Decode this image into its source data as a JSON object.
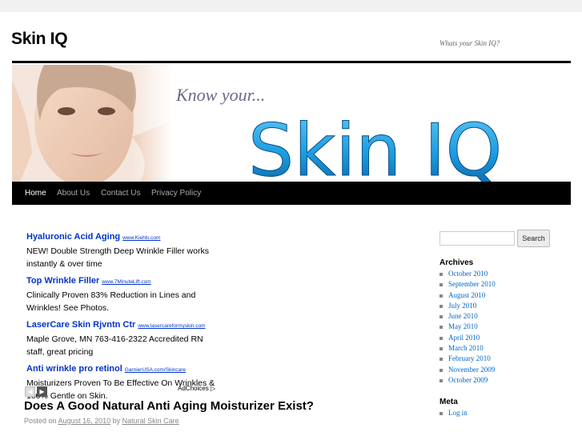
{
  "site": {
    "title": "Skin IQ",
    "description": "Whats your Skin IQ?"
  },
  "banner": {
    "tagline": "Know your...",
    "brand": "Skin IQ"
  },
  "nav": [
    {
      "label": "Home"
    },
    {
      "label": "About Us"
    },
    {
      "label": "Contact Us"
    },
    {
      "label": "Privacy Policy"
    }
  ],
  "ads": [
    {
      "title": "Hyaluronic Acid Aging",
      "url": "www.Kiehls.com",
      "text": "NEW! Double Strength Deep Wrinkle Filler works instantly & over time"
    },
    {
      "title": "Top Wrinkle Filler",
      "url": "www.7MinuteLift.com",
      "text": "Clinically Proven 83% Reduction in Lines and Wrinkles! See Photos."
    },
    {
      "title": "LaserCare Skin Rjvntn Ctr",
      "url": "www.lasercareformyskin.com",
      "text": "Maple Grove, MN 763-416-2322 Accredited RN staff, great pricing"
    },
    {
      "title": "Anti wrinkle pro retinol",
      "url": "GarnierUSA.com/Skincare",
      "text": "Moisturizers Proven To Be Effective On Wrinkles & 100% Gentle on Skin."
    }
  ],
  "ad_choices": "AdChoices",
  "post": {
    "title": "Does A Good Natural Anti Aging Moisturizer Exist?",
    "posted_on": "Posted on",
    "date": "August 16, 2010",
    "by": "by",
    "author": "Natural Skin Care"
  },
  "sidebar": {
    "search_button": "Search",
    "archives_title": "Archives",
    "archives": [
      "October 2010",
      "September 2010",
      "August 2010",
      "July 2010",
      "June 2010",
      "May 2010",
      "April 2010",
      "March 2010",
      "February 2010",
      "November 2009",
      "October 2009"
    ],
    "meta_title": "Meta",
    "meta": [
      "Log in"
    ]
  },
  "colors": {
    "nav_bg": "#000000",
    "link": "#0066cc",
    "ad_link": "#0033cc",
    "banner_text": "#1a9be0"
  }
}
